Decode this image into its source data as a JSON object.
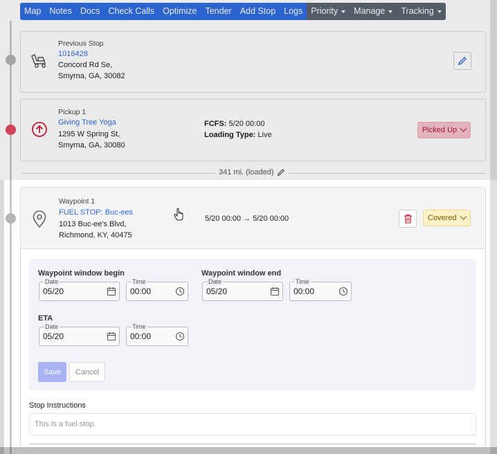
{
  "nav": {
    "buttons": [
      "Map",
      "Notes",
      "Docs",
      "Check Calls",
      "Optimize",
      "Tender",
      "Add Stop",
      "Logs"
    ],
    "dropdowns": [
      "Priority",
      "Manage",
      "Tracking"
    ]
  },
  "previous_stop": {
    "label": "Previous Stop",
    "id": "1016428",
    "address_line1": "Concord Rd Se,",
    "address_line2": "Smyrna, GA, 30082",
    "icon": "truck-icon"
  },
  "pickup": {
    "label": "Pickup 1",
    "name": "Giving Tree Yoga",
    "address_line1": "1295 W Spring St,",
    "address_line2": "Smyrna, GA, 30080",
    "fcfs_label": "FCFS:",
    "fcfs_value": "5/20 00:00",
    "loading_label": "Loading Type:",
    "loading_value": "Live",
    "status": "Picked Up",
    "status_bg": "#f6c3cc",
    "status_color": "#b01733",
    "icon": "arrow-up-circle-icon"
  },
  "segment": {
    "miles": "341 mi. (loaded)"
  },
  "waypoint": {
    "label": "Waypoint 1",
    "name": "FUEL STOP: Buc-ees",
    "address_line1": "1013 Buc-ee's Blvd,",
    "address_line2": "Richmond, KY, 40475",
    "window": "5/20 00:00",
    "window_arrow": "→",
    "window_end": "5/20 00:00",
    "status": "Covered",
    "status_bg": "#fdf1c7",
    "status_color": "#7a5a00",
    "icon": "map-pin-icon"
  },
  "form": {
    "begin_title": "Waypoint window begin",
    "end_title": "Waypoint window end",
    "eta_title": "ETA",
    "date_label": "Date",
    "time_label": "Time",
    "begin_date": "05/20",
    "begin_time": "00:00",
    "end_date": "05/20",
    "end_time": "00:00",
    "eta_date": "05/20",
    "eta_time": "00:00",
    "save_label": "Save",
    "cancel_label": "Cancel"
  },
  "instructions": {
    "title": "Stop Instructions",
    "placeholder": "This is a fuel stop."
  }
}
